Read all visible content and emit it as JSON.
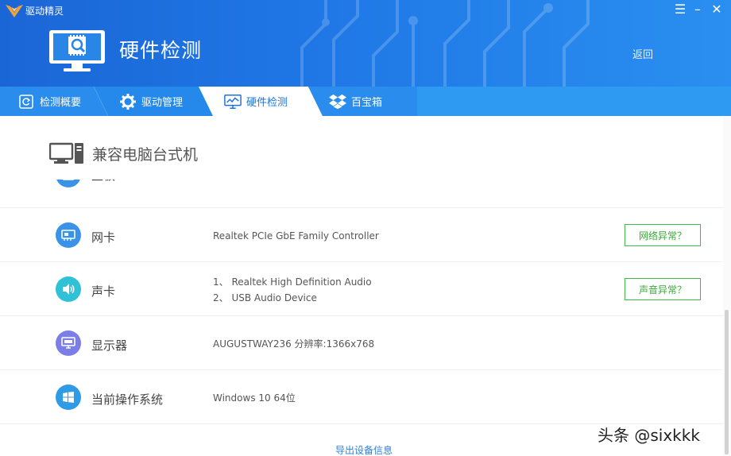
{
  "titlebar": {
    "app_name": "驱动精灵",
    "menu_glyph": "☰",
    "minimize_glyph": "–",
    "close_glyph": "✕"
  },
  "header": {
    "title": "硬件检测",
    "back_label": "返回"
  },
  "tabs": [
    {
      "label": "检测概要",
      "icon": "refresh-icon",
      "active": false
    },
    {
      "label": "驱动管理",
      "icon": "gear-icon",
      "active": false
    },
    {
      "label": "硬件检测",
      "icon": "monitor-chart-icon",
      "active": true
    },
    {
      "label": "百宝箱",
      "icon": "dropbox-icon",
      "active": false
    }
  ],
  "machine": {
    "label": "兼容电脑台式机",
    "icon": "desktop-computer-icon"
  },
  "rows": [
    {
      "name": "主板",
      "icon": "motherboard-icon",
      "color": "#3a93e6",
      "values": []
    },
    {
      "name": "网卡",
      "icon": "network-card-icon",
      "color": "#3a93e6",
      "values": [
        "Realtek PCIe GbE Family Controller"
      ],
      "action": "网络异常？"
    },
    {
      "name": "声卡",
      "icon": "speaker-icon",
      "color": "#2fc1d6",
      "values": [
        "1、 Realtek High Definition Audio",
        "2、 USB Audio Device"
      ],
      "action": "声音异常？"
    },
    {
      "name": "显示器",
      "icon": "display-icon",
      "color": "#7b7ee6",
      "values": [
        "AUGUSTWAY236  分辨率:1366x768"
      ]
    },
    {
      "name": "当前操作系统",
      "icon": "windows-icon",
      "color": "#2f9be6",
      "values": [
        "Windows 10 64位"
      ]
    }
  ],
  "footer": {
    "export_label": "导出设备信息"
  },
  "watermark": "头条 @sixkkk",
  "colors": {
    "header_blue": "#1f78e6",
    "tab_blue": "#1f84e8",
    "action_green": "#45b845",
    "link_blue": "#2f7fd6"
  }
}
